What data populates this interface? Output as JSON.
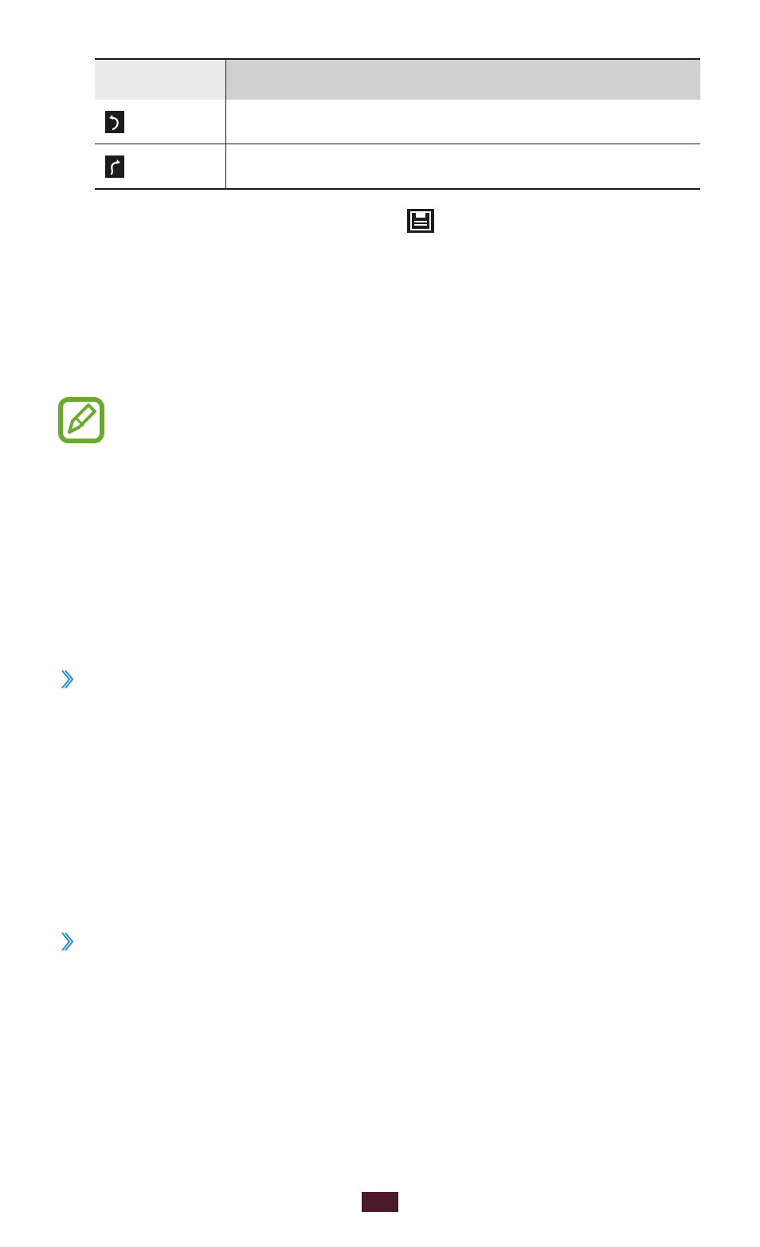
{
  "icon_table": {
    "header": {
      "icon_col": "",
      "function_col": ""
    },
    "rows": [
      {
        "icon": "undo-icon",
        "function": ""
      },
      {
        "icon": "redo-icon",
        "function": ""
      }
    ]
  },
  "inline_icons": {
    "save": "save-icon"
  },
  "note": {
    "icon": "note-pencil-icon",
    "color": "#6aaa2c"
  },
  "sections": [
    {
      "icon": "chevron-right-icon",
      "color": "#1e8fd6"
    },
    {
      "icon": "chevron-right-icon",
      "color": "#1e8fd6"
    }
  ],
  "page_tab": {
    "color": "#4a1a28",
    "number": ""
  }
}
